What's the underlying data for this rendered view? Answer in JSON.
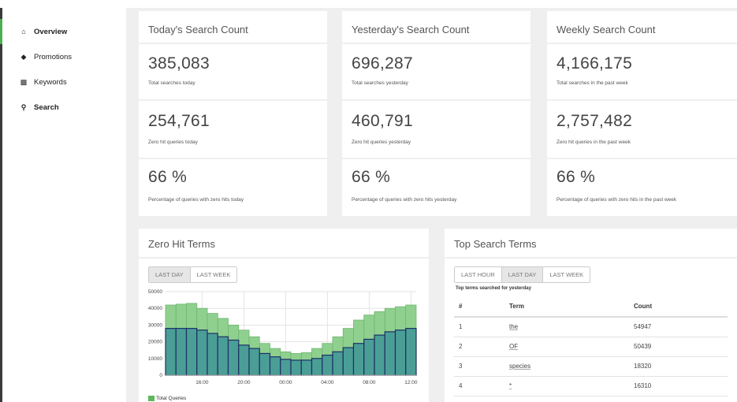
{
  "sidebar": {
    "items": [
      {
        "label": "Overview",
        "icon": "home-icon"
      },
      {
        "label": "Promotions",
        "icon": "tag-icon"
      },
      {
        "label": "Keywords",
        "icon": "keyboard-icon"
      },
      {
        "label": "Search",
        "icon": "search-icon"
      }
    ]
  },
  "stats": [
    {
      "title": "Today's Search Count",
      "rows": [
        {
          "value": "385,083",
          "desc": "Total searches today"
        },
        {
          "value": "254,761",
          "desc": "Zero hit queries today"
        },
        {
          "value": "66 %",
          "desc": "Percentage of queries with zero hits today"
        }
      ]
    },
    {
      "title": "Yesterday's Search Count",
      "rows": [
        {
          "value": "696,287",
          "desc": "Total searches yesterday"
        },
        {
          "value": "460,791",
          "desc": "Zero hit queries yesterday"
        },
        {
          "value": "66 %",
          "desc": "Percentage of queries with zero hits yesterday"
        }
      ]
    },
    {
      "title": "Weekly Search Count",
      "rows": [
        {
          "value": "4,166,175",
          "desc": "Total searches in the past week"
        },
        {
          "value": "2,757,482",
          "desc": "Zero hit queries in the past week"
        },
        {
          "value": "66 %",
          "desc": "Percentage of queries with zero hits in the past week"
        }
      ]
    }
  ],
  "zero_hit": {
    "title": "Zero Hit Terms",
    "buttons": [
      "LAST DAY",
      "LAST WEEK"
    ],
    "active": "LAST DAY",
    "legend": "Total Queries"
  },
  "top_terms": {
    "title": "Top Search Terms",
    "buttons": [
      "LAST HOUR",
      "LAST DAY",
      "LAST WEEK"
    ],
    "active": "LAST DAY",
    "caption": "Top terms searched for yesterday",
    "headers": [
      "#",
      "Term",
      "Count"
    ],
    "rows": [
      [
        "1",
        "the",
        "54947"
      ],
      [
        "2",
        "OF",
        "50439"
      ],
      [
        "3",
        "species",
        "18320"
      ],
      [
        "4",
        "*",
        "16310"
      ]
    ]
  },
  "colors": {
    "accent": "#4caf50",
    "total_bar": "#8fd08f",
    "zero_bar": "#4a9e96",
    "bar_outline": "#1f2f66"
  },
  "chart_data": {
    "type": "bar",
    "x_ticks": [
      "16:00",
      "20:00",
      "00:00",
      "04:00",
      "08:00",
      "12:00"
    ],
    "ylim": [
      0,
      50000
    ],
    "y_ticks": [
      0,
      10000,
      20000,
      30000,
      40000,
      50000
    ],
    "grid": true,
    "legend_position": "bottom-left",
    "series": [
      {
        "name": "Total Queries",
        "values": [
          42000,
          42500,
          43000,
          40000,
          37000,
          34000,
          30000,
          27000,
          23000,
          19000,
          16000,
          14000,
          13000,
          13500,
          16000,
          19000,
          23000,
          28000,
          33000,
          36000,
          38000,
          40000,
          41000,
          42000
        ]
      },
      {
        "values": [
          28000,
          28000,
          28000,
          27000,
          25000,
          23000,
          21000,
          18000,
          16000,
          13000,
          11000,
          9500,
          9000,
          9000,
          10000,
          12000,
          14000,
          16500,
          19000,
          21500,
          24000,
          26000,
          27000,
          28000
        ]
      }
    ]
  }
}
